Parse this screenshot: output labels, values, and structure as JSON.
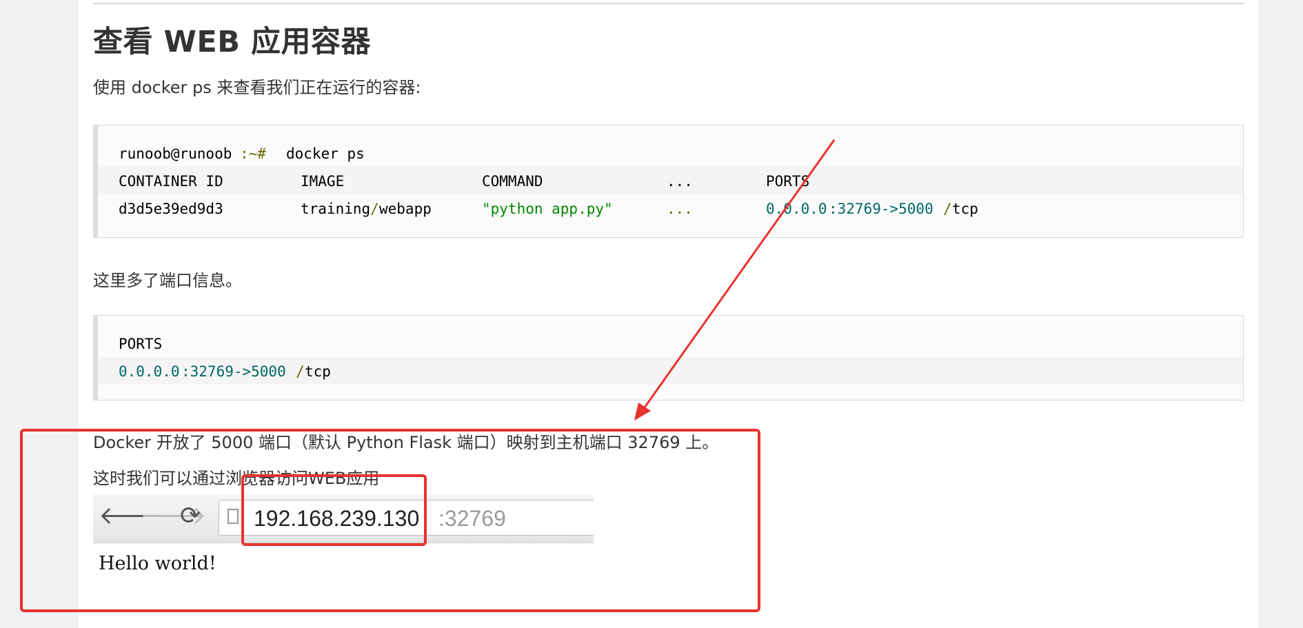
{
  "heading": "查看 WEB 应用容器",
  "intro": "使用 docker ps 来查看我们正在运行的容器:",
  "code1": {
    "prompt_user": "runoob@runoob",
    "prompt_sep": ":~#",
    "command": "docker ps",
    "headers": [
      "CONTAINER ID",
      "IMAGE",
      "COMMAND",
      "...",
      "PORTS"
    ],
    "row": {
      "container_id": "d3d5e39ed9d3",
      "image_a": "training",
      "image_slash": "/",
      "image_b": "webapp",
      "command": "\"python app.py\"",
      "ellipsis": "...",
      "port_addr": "0.0.0.0",
      "port_rest": ":32769->5000",
      "port_slash": "/",
      "port_proto": "tcp"
    }
  },
  "ports_note": "这里多了端口信息。",
  "code2": {
    "header": "PORTS",
    "port_addr": "0.0.0.0",
    "port_rest": ":32769->5000",
    "port_slash": "/",
    "port_proto": "tcp"
  },
  "flask_note": "Docker 开放了 5000 端口（默认 Python Flask 端口）映射到主机端口 32769 上。",
  "browser_note": "这时我们可以通过浏览器访问WEB应用",
  "browser": {
    "back": "🡐",
    "forward": "🡒",
    "reload": "⟳",
    "url_host": "192.168.239.130",
    "url_port": ":32769",
    "page_text": "Hello world!"
  },
  "colors": {
    "annotation_red": "#e8322d",
    "code_green": "#008800",
    "code_teal": "#006666"
  }
}
